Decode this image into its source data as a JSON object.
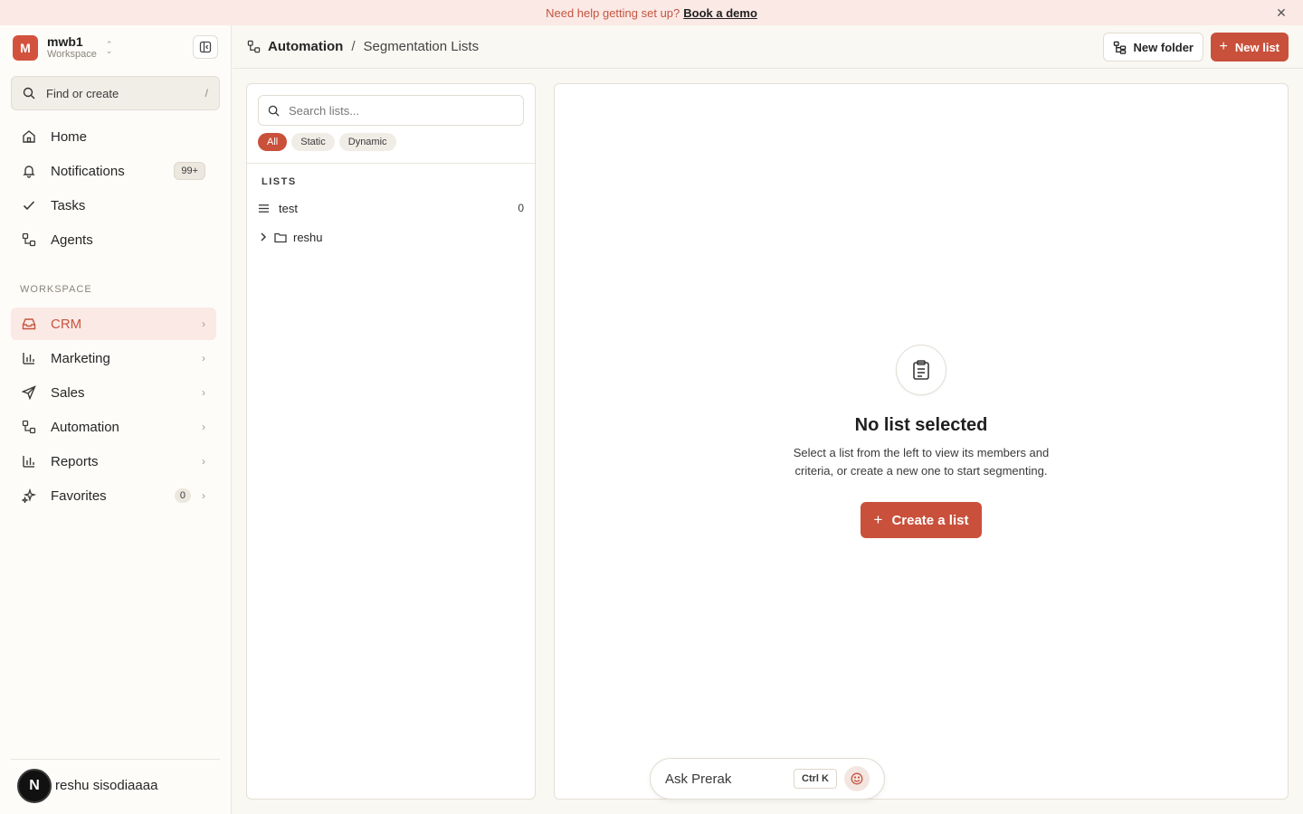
{
  "banner": {
    "text": "Need help getting set up?",
    "cta": "Book a demo",
    "close": "✕"
  },
  "workspace": {
    "initial": "M",
    "name": "mwb1",
    "subtitle": "Workspace"
  },
  "find": {
    "label": "Find or create",
    "shortcut": "/"
  },
  "nav": {
    "home": "Home",
    "notifications": "Notifications",
    "notifications_badge": "99+",
    "tasks": "Tasks",
    "agents": "Agents"
  },
  "workspace_section": {
    "label": "WORKSPACE",
    "crm": "CRM",
    "marketing": "Marketing",
    "sales": "Sales",
    "automation": "Automation",
    "reports": "Reports",
    "favorites": "Favorites",
    "favorites_count": "0"
  },
  "user": {
    "initial": "N",
    "name": "reshu sisodiaaaa"
  },
  "breadcrumb": {
    "parent": "Automation",
    "separator": "/",
    "current": "Segmentation Lists"
  },
  "toolbar": {
    "new_folder": "New folder",
    "new_list": "New list"
  },
  "list_panel": {
    "search_placeholder": "Search lists...",
    "filters": [
      "All",
      "Static",
      "Dynamic"
    ],
    "section_label": "LISTS",
    "items": [
      {
        "name": "test",
        "count": "0"
      }
    ],
    "folders": [
      {
        "name": "reshu"
      }
    ]
  },
  "empty_state": {
    "title": "No list selected",
    "description": "Select a list from the left to view its members and criteria, or create a new one to start segmenting.",
    "button": "Create a list"
  },
  "assistant": {
    "label": "Ask Prerak",
    "shortcut": "Ctrl K"
  },
  "colors": {
    "accent": "#c9503b",
    "accent_soft": "#fbe9e6",
    "background": "#faf8f3"
  }
}
